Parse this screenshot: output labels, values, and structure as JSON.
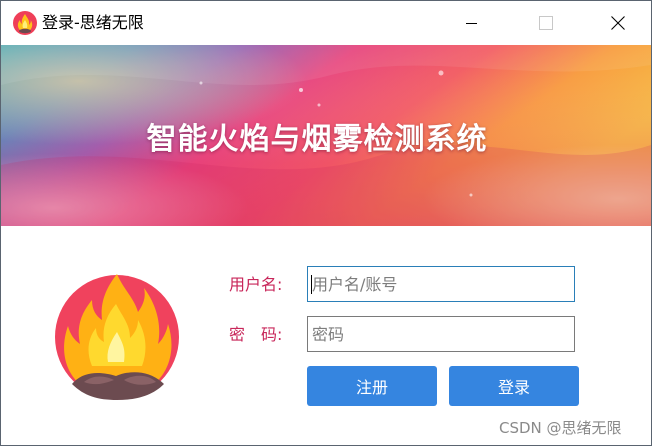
{
  "window": {
    "title": "登录-思绪无限",
    "controls": [
      "minimize-icon",
      "maximize-icon",
      "close-icon"
    ]
  },
  "banner": {
    "title": "智能火焰与烟雾检测系统"
  },
  "form": {
    "username_label": "用户名:",
    "username_placeholder": "用户名/账号",
    "username_value": "",
    "password_label": "密　码:",
    "password_placeholder": "密码",
    "password_value": "",
    "register_label": "注册",
    "login_label": "登录"
  },
  "watermark": "CSDN @思绪无限",
  "colors": {
    "label": "#c8265a",
    "button": "#3585e0",
    "avatar_bg": "#f0425d"
  }
}
